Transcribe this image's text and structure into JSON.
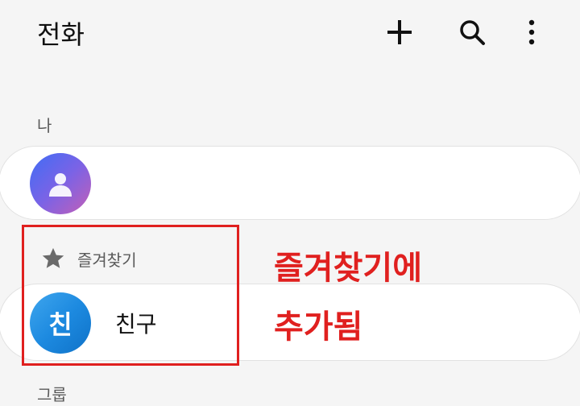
{
  "header": {
    "title": "전화",
    "add_icon": "plus-icon",
    "search_icon": "search-icon",
    "more_icon": "more-vert-icon"
  },
  "sections": {
    "me_label": "나",
    "favorites_label": "즐겨찾기",
    "groups_label": "그룹"
  },
  "favorites": [
    {
      "avatar_initial": "친",
      "name": "친구"
    }
  ],
  "annotation": {
    "line1": "즐겨찾기에",
    "line2": "추가됨"
  },
  "colors": {
    "background": "#f5f5f5",
    "card": "#ffffff",
    "annotation_red": "#e0201f",
    "friend_avatar": "#1d8ae0"
  }
}
